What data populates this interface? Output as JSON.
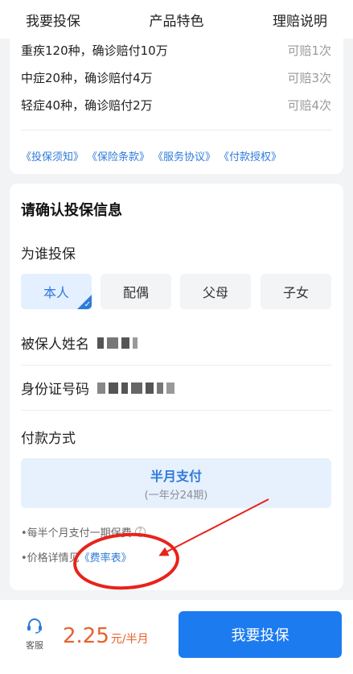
{
  "nav": {
    "tabs": [
      "我要投保",
      "产品特色",
      "理赔说明"
    ]
  },
  "coverage": {
    "rows": [
      {
        "desc": "重疾120种，确诊赔付10万",
        "times": "可赔1次"
      },
      {
        "desc": "中症20种，确诊赔付4万",
        "times": "可赔3次"
      },
      {
        "desc": "轻症40种，确诊赔付2万",
        "times": "可赔4次"
      }
    ],
    "links": [
      "《投保须知》",
      "《保险条款》",
      "《服务协议》",
      "《付款授权》"
    ]
  },
  "form": {
    "title": "请确认投保信息",
    "who_label": "为谁投保",
    "options": [
      "本人",
      "配偶",
      "父母",
      "子女"
    ],
    "selected": "本人",
    "name_label": "被保人姓名",
    "id_label": "身份证号码",
    "payment_label": "付款方式",
    "payment_main": "半月支付",
    "payment_sub": "(一年分24期)",
    "note1": "•每半个月支付一期保费",
    "note2_prefix": "•价格详情见",
    "note2_link": "《费率表》"
  },
  "footer": {
    "service_label": "客服",
    "price_amount": "2.25",
    "price_unit": "元/半月",
    "buy_label": "我要投保"
  },
  "colors": {
    "accent": "#2f7bd9",
    "button": "#1d7bf0",
    "price": "#e8612b",
    "annotation": "#e8231a"
  }
}
